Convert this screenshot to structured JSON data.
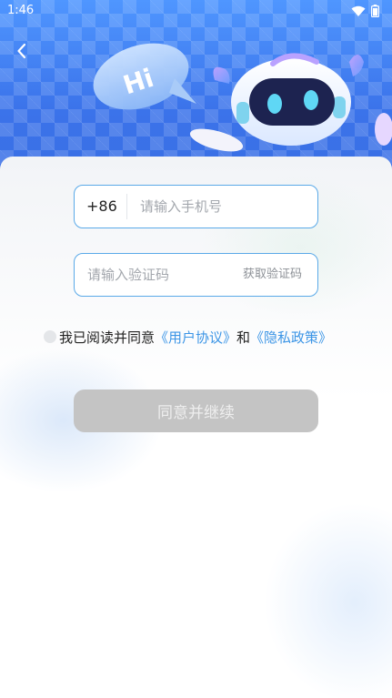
{
  "status_bar": {
    "time": "1:46",
    "wifi_icon": "wifi-icon",
    "battery_icon": "battery-icon"
  },
  "header": {
    "back_icon": "chevron-left-icon",
    "bubble_text": "Hi",
    "brand_color": "#3d7cf0"
  },
  "form": {
    "phone": {
      "prefix": "+86",
      "placeholder": "请输入手机号",
      "value": ""
    },
    "code": {
      "placeholder": "请输入验证码",
      "value": "",
      "get_code_label": "获取验证码"
    },
    "agreement": {
      "checked": false,
      "prefix_text": "我已阅读并同意",
      "user_agreement": "《用户协议》",
      "conjunction": "和",
      "privacy_policy": "《隐私政策》",
      "link_color": "#3c95e6"
    },
    "submit_label": "同意并继续",
    "submit_disabled": true
  }
}
